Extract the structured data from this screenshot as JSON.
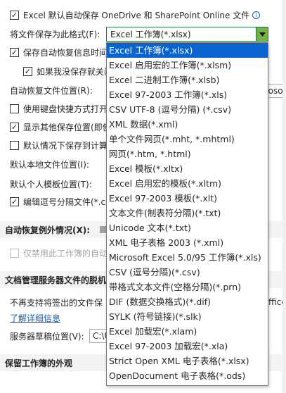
{
  "options": {
    "autosave_onedrive_label": "Excel 默认自动保存 OneDrive 和 SharePoint Online 文件",
    "save_format_label": "将文件保存为此格式(F):",
    "save_format_value": "Excel 工作簿(*.xlsx)",
    "autorecover_interval_label": "保存自动恢复信息时间",
    "keep_last_version_label": "如果我没保存就关闭",
    "autorecover_location_label": "自动恢复文件位置(R):",
    "autorecover_location_value": "rosof",
    "keyboard_shortcut_label": "使用键盘快捷方式打开",
    "show_more_locations_label": "显示其他保存位置(即使",
    "default_save_computer_label": "默认情况下保存到计算",
    "default_local_location_label": "默认本地文件位置(I):",
    "default_template_location_label": "默认个人模板位置(T):",
    "edit_csv_label": "编辑逗号分隔文件(*.csv",
    "autorecover_exceptions_label": "自动恢复例外情况(X):",
    "disable_autorecover_label": "仅禁用此工作簿的自动",
    "doc_server_section_label": "文档管理服务器文件的脱机",
    "checked_out_text": "不再支持将签出的文件保",
    "checked_out_suffix": "ffice",
    "learn_more_link": "了解详细信息",
    "server_drafts_label": "服务器草稿位置(V):",
    "server_drafts_value": "C:\\U",
    "preserve_section_label": "保留工作簿的外观"
  },
  "format_options": [
    "Excel 工作簿(*.xlsx)",
    "Excel 启用宏的工作簿(*.xlsm)",
    "Excel 二进制工作簿(*.xlsb)",
    "Excel 97-2003 工作簿(*.xls)",
    "CSV UTF-8 (逗号分隔) (*.csv)",
    "XML 数据(*.xml)",
    "单个文件网页(*.mht, *.mhtml)",
    "网页(*.htm, *.html)",
    "Excel 模板(*.xltx)",
    "Excel 启用宏的模板(*.xltm)",
    "Excel 97-2003 模板(*.xlt)",
    "文本文件(制表符分隔)(*.txt)",
    "Unicode 文本(*.txt)",
    "XML 电子表格 2003 (*.xml)",
    "Microsoft Excel 5.0/95 工作簿(*.xls)",
    "CSV (逗号分隔)(*.csv)",
    "带格式文本文件(空格分隔)(*.prn)",
    "DIF (数据交换格式)(*.dif)",
    "SYLK (符号链接)(*.slk)",
    "Excel 加载宏(*.xlam)",
    "Excel 97-2003 加载宏(*.xla)",
    "Strict Open XML 电子表格(*.xlsx)",
    "OpenDocument 电子表格(*.ods)"
  ],
  "colors": {
    "accent_green": "#217346",
    "dropdown_button": "#75b343",
    "selected_option": "#0a64d0",
    "link": "#1e5aa8"
  },
  "icons": {
    "check": "✓",
    "info": "i",
    "dropdown_arrow": "▼"
  }
}
